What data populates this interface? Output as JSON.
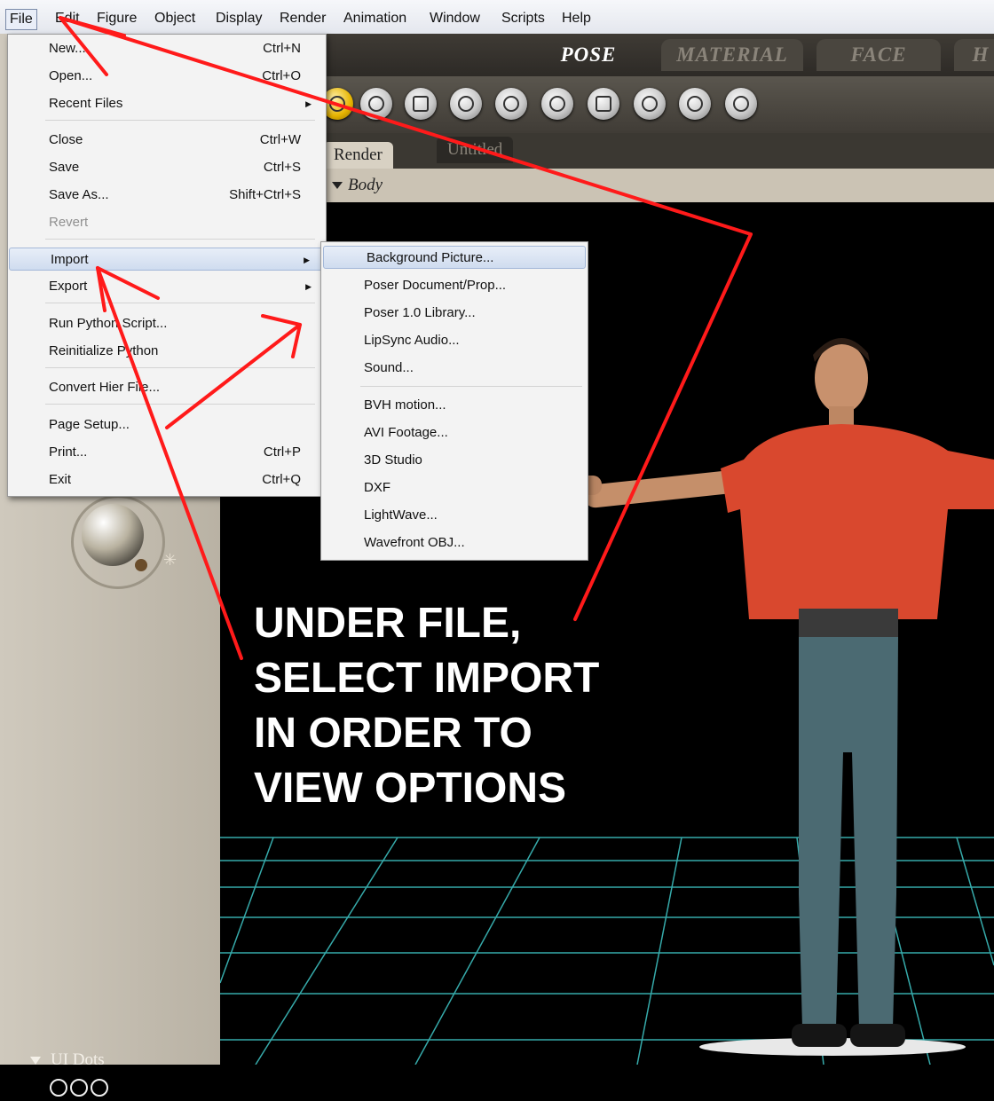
{
  "menubar": {
    "items": [
      "File",
      "Edit",
      "Figure",
      "Object",
      "Display",
      "Render",
      "Animation",
      "Window",
      "Scripts",
      "Help"
    ]
  },
  "mode_tabs": [
    "POSE",
    "MATERIAL",
    "FACE",
    "H"
  ],
  "doc_tabs": [
    "Render",
    "Untitled"
  ],
  "body_selector": "Body",
  "left_panel": {
    "ui_dots_label": "UI Dots"
  },
  "file_menu": [
    {
      "label": "New...",
      "shortcut": "Ctrl+N"
    },
    {
      "label": "Open...",
      "shortcut": "Ctrl+O"
    },
    {
      "label": "Recent Files",
      "shortcut": "",
      "submenu": true
    },
    {
      "label": "Close",
      "shortcut": "Ctrl+W"
    },
    {
      "label": "Save",
      "shortcut": "Ctrl+S"
    },
    {
      "label": "Save As...",
      "shortcut": "Shift+Ctrl+S"
    },
    {
      "label": "Revert",
      "shortcut": "",
      "disabled": true
    },
    {
      "label": "Import",
      "shortcut": "",
      "submenu": true,
      "highlighted": true
    },
    {
      "label": "Export",
      "shortcut": "",
      "submenu": true
    },
    {
      "label": "Run Python Script...",
      "shortcut": ""
    },
    {
      "label": "Reinitialize Python",
      "shortcut": ""
    },
    {
      "label": "Convert Hier File...",
      "shortcut": ""
    },
    {
      "label": "Page Setup...",
      "shortcut": ""
    },
    {
      "label": "Print...",
      "shortcut": "Ctrl+P"
    },
    {
      "label": "Exit",
      "shortcut": "Ctrl+Q"
    }
  ],
  "import_menu": [
    {
      "label": "Background Picture...",
      "highlighted": true
    },
    {
      "label": "Poser Document/Prop..."
    },
    {
      "label": "Poser 1.0 Library..."
    },
    {
      "label": "LipSync Audio..."
    },
    {
      "label": "Sound..."
    },
    {
      "label": "BVH motion..."
    },
    {
      "label": "AVI Footage..."
    },
    {
      "label": "3D Studio"
    },
    {
      "label": "DXF"
    },
    {
      "label": "LightWave..."
    },
    {
      "label": "Wavefront OBJ..."
    }
  ],
  "annotation": [
    "UNDER FILE,",
    "SELECT IMPORT",
    "IN ORDER TO",
    "VIEW OPTIONS"
  ],
  "colors": {
    "arrow": "#ff1a1a",
    "grid": "#40c8c8",
    "shirt": "#d9482e",
    "jeans": "#4b6a72",
    "menu_highlight": "#cfdcef"
  }
}
